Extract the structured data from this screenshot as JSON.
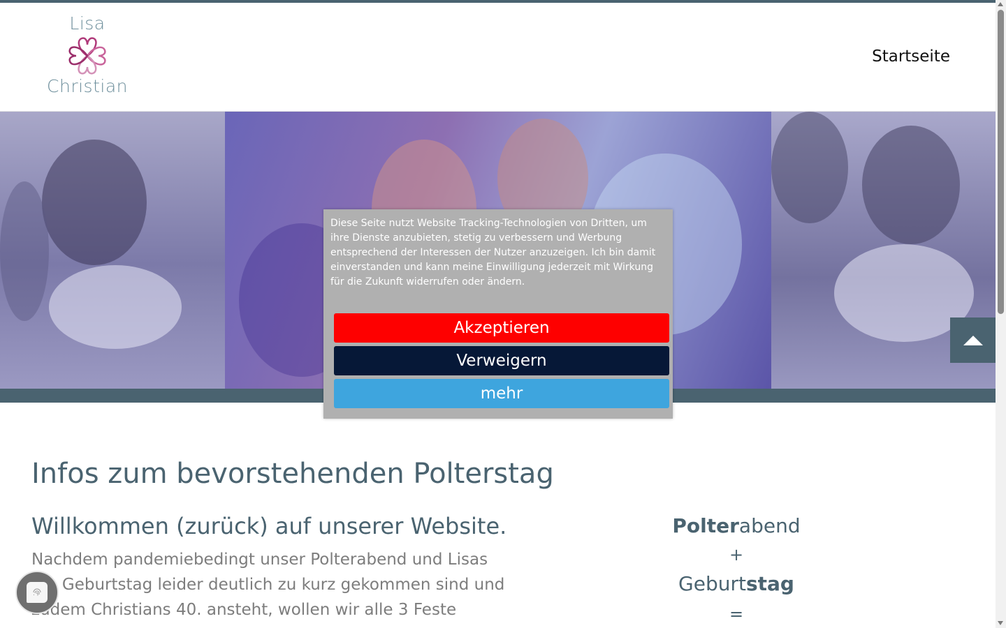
{
  "logo": {
    "top_name": "Lisa",
    "bottom_name": "Christian"
  },
  "nav": {
    "startseite": "Startseite"
  },
  "cookie_banner": {
    "text": "Diese Seite nutzt Website Tracking-Technologien von Dritten, um ihre Dienste anzubieten, stetig zu verbessern und Werbung entsprechend der Interessen der Nutzer anzuzeigen. Ich bin damit einverstanden und kann meine Einwilligung jederzeit mit Wirkung für die Zukunft widerrufen oder ändern.",
    "accept_label": "Akzeptieren",
    "decline_label": "Verweigern",
    "more_label": "mehr",
    "colors": {
      "accept": "#fe0000",
      "decline": "#061837",
      "more": "#3ea5de",
      "background": "#b0b0b0"
    }
  },
  "content": {
    "title": "Infos zum bevorstehenden Polterstag",
    "subtitle": "Willkommen (zurück) auf unserer Website.",
    "paragraph": "Nachdem pandemiebedingt unser Polterabend und Lisas 40. Geburtstag leider deutlich zu kurz gekommen sind und zudem Christians 40. ansteht, wollen wir alle 3 Feste"
  },
  "sidebar_formula": {
    "part1_bold": "Polter",
    "part1_rest": "abend",
    "plus": "+",
    "part2_start": "Geburt",
    "part2_bold": "stag",
    "equals": "="
  },
  "theme": {
    "accent": "#4a6370",
    "heart_pink": "#b03a7a"
  },
  "icons": {
    "scroll_top": "triangle-up-icon",
    "privacy": "fingerprint-icon"
  }
}
